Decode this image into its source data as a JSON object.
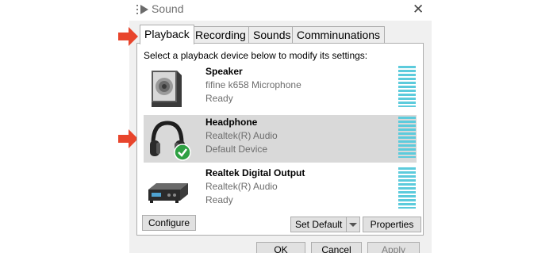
{
  "window": {
    "title": "Sound",
    "close_glyph": "✕"
  },
  "tabs": [
    {
      "label": "Playback",
      "active": true
    },
    {
      "label": "Recording"
    },
    {
      "label": "Sounds"
    },
    {
      "label": "Comminunations"
    }
  ],
  "instruction": "Select a playback device below to modify its settings:",
  "devices": [
    {
      "name": "Speaker",
      "description": "fifine k658 Microphone",
      "status": "Ready",
      "icon": "speaker-icon"
    },
    {
      "name": "Headphone",
      "description": "Realtek(R) Audio",
      "status": "Default Device",
      "icon": "headphone-icon",
      "selected": true,
      "badge": "green-checkmark-icon"
    },
    {
      "name": "Realtek Digital Output",
      "description": "Realtek(R) Audio",
      "status": "Ready",
      "icon": "digital-output-icon"
    }
  ],
  "buttons": {
    "configure": "Configure",
    "set_default": "Set Default",
    "properties": "Properties",
    "ok": "OK",
    "cancel": "Cancel",
    "apply": "Apply"
  },
  "colors": {
    "annotation_arrow": "#e8452c",
    "level_meter": "#5ccbdc",
    "selected_row": "#d9d9d9",
    "check_badge": "#2ea043"
  }
}
